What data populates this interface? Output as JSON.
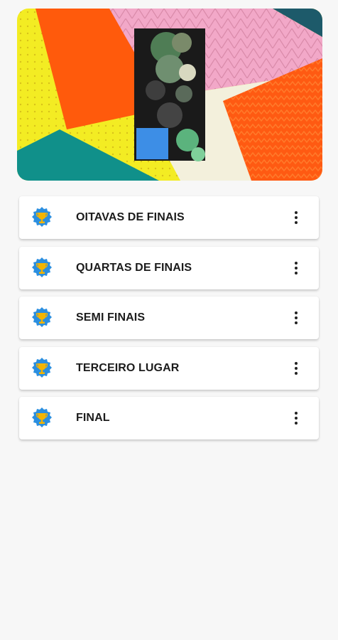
{
  "banner": {
    "image": "colorful-geometric-banner-with-blurred-player-photo"
  },
  "stages": [
    {
      "label": "OITAVAS DE FINAIS",
      "icon": "trophy-icon"
    },
    {
      "label": "QUARTAS DE FINAIS",
      "icon": "trophy-icon"
    },
    {
      "label": "SEMI FINAIS",
      "icon": "trophy-icon"
    },
    {
      "label": "TERCEIRO LUGAR",
      "icon": "trophy-icon"
    },
    {
      "label": "FINAL",
      "icon": "trophy-icon"
    }
  ],
  "colors": {
    "trophy_badge": "#2b8fe0",
    "trophy_cup": "#f4b400",
    "text": "#1c1c1c",
    "background": "#f7f7f7"
  }
}
